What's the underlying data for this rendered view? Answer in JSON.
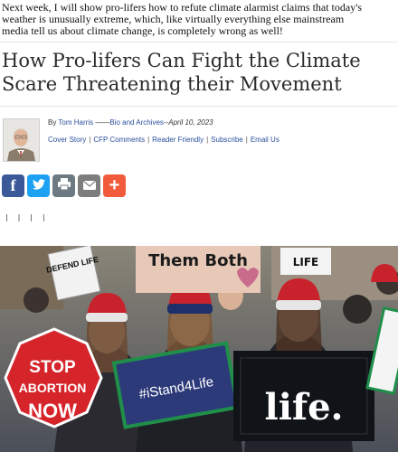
{
  "article": {
    "intro": [
      "Next week, I will show pro-lifers how to refute climate alarmist claims that today's",
      "weather is unusually extreme, which, like virtually everything else mainstream",
      "media tell us about climate change, is completely wrong as well!"
    ],
    "headline": "How Pro-lifers Can Fight the Climate Scare Threatening their Movement"
  },
  "byline": {
    "by": "By",
    "author": "Tom Harris",
    "separator": " ——",
    "bio": "Bio and Archives",
    "date": "--April 10, 2023"
  },
  "links": [
    "Cover Story",
    "CFP Comments",
    "Reader Friendly",
    "Subscribe",
    "Email Us"
  ],
  "share": [
    {
      "icon": "facebook-icon",
      "glyph": "f",
      "color": "#3b5998"
    },
    {
      "icon": "twitter-icon",
      "glyph": "t",
      "color": "#1da1f2"
    },
    {
      "icon": "print-icon",
      "glyph": "⎙",
      "color": "#6d7a82"
    },
    {
      "icon": "email-icon",
      "glyph": "✉",
      "color": "#7d7d7d"
    },
    {
      "icon": "plus-icon",
      "glyph": "+",
      "color": "#f15a3a"
    }
  ],
  "marks": "| | | |",
  "photo": {
    "signs": {
      "defend": "DEFEND LIFE",
      "them_both": "Them Both",
      "life_top": "LIFE",
      "stop": "STOP",
      "abortion": "ABORTION",
      "now": "NOW",
      "istand": "#iStand4Life",
      "life": "life."
    }
  }
}
